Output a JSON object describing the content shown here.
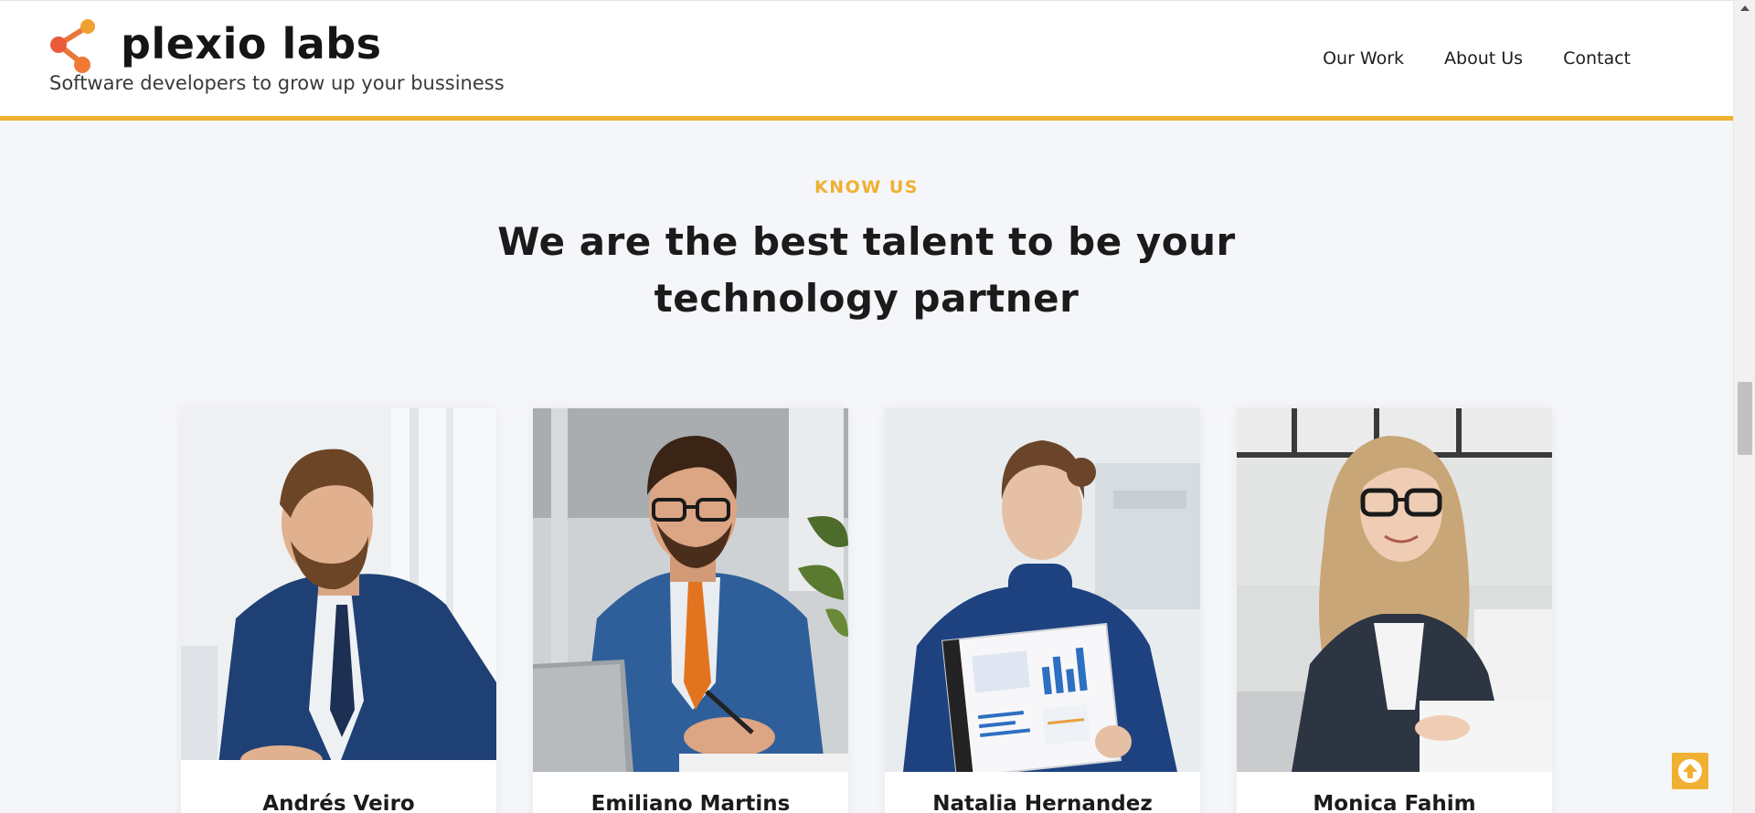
{
  "brand": {
    "name": "plexio labs",
    "tagline": "Software developers to grow up your bussiness",
    "logo_icon": "share-nodes-icon",
    "accent_color": "#f0b032"
  },
  "nav": {
    "items": [
      {
        "label": "Our Work"
      },
      {
        "label": "About Us"
      },
      {
        "label": "Contact"
      }
    ]
  },
  "section": {
    "eyebrow": "KNOW US",
    "title": "We are the best talent to be your technology partner"
  },
  "team": {
    "members": [
      {
        "name": "Andrés Veiro",
        "photo": "man-in-blue-suit-with-beard"
      },
      {
        "name": "Emiliano Martins",
        "photo": "man-with-glasses-and-orange-tie-writing"
      },
      {
        "name": "Natalia Hernandez",
        "photo": "woman-in-blue-turtleneck-holding-folder"
      },
      {
        "name": "Monica Fahim",
        "photo": "woman-with-glasses-smiling-at-desk"
      }
    ]
  },
  "back_to_top": {
    "icon": "arrow-up-icon"
  }
}
